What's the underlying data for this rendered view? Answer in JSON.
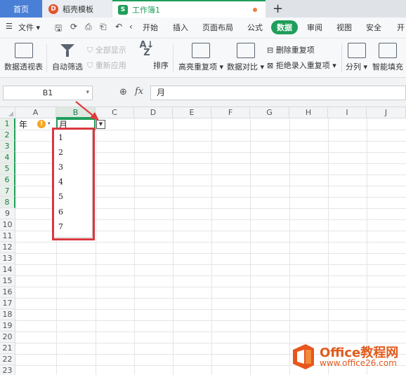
{
  "tabs": {
    "home": "首页",
    "template": "稻壳模板",
    "workbook": "工作簿1",
    "new_tab": "+"
  },
  "menu": {
    "file": "文件",
    "items": [
      "开始",
      "插入",
      "页面布局",
      "公式",
      "数据",
      "审阅",
      "视图",
      "安全",
      "开"
    ],
    "active": "数据"
  },
  "ribbon": {
    "pivot": "数据透视表",
    "autofilter": "自动筛选",
    "show_all": "全部显示",
    "reapply": "重新应用",
    "sort": "排序",
    "highlight_dup": "高亮重复项",
    "compare": "数据对比",
    "remove_dup": "删除重复项",
    "reject_dup": "拒绝录入重复项",
    "split": "分列",
    "smart_fill": "智能填充"
  },
  "formula_bar": {
    "name_box": "B1",
    "fx": "fx",
    "value": "月"
  },
  "grid": {
    "columns": [
      "A",
      "B",
      "C",
      "D",
      "E",
      "F",
      "G",
      "H",
      "I",
      "J"
    ],
    "rows": [
      "1",
      "2",
      "3",
      "4",
      "5",
      "6",
      "7",
      "8",
      "9",
      "10",
      "11",
      "12",
      "13",
      "14",
      "15",
      "16",
      "17",
      "18",
      "19",
      "20",
      "21",
      "22",
      "23"
    ],
    "cells": {
      "A1": "年",
      "B1": "月"
    }
  },
  "dropdown": {
    "options": [
      "1",
      "2",
      "3",
      "4",
      "5",
      "6",
      "7"
    ]
  },
  "watermark": {
    "brand": "Office教程网",
    "url": "www.office26.com"
  },
  "colors": {
    "accent_green": "#1f9e5a",
    "highlight_red": "#d9383f",
    "brand_orange": "#e25a1c"
  }
}
